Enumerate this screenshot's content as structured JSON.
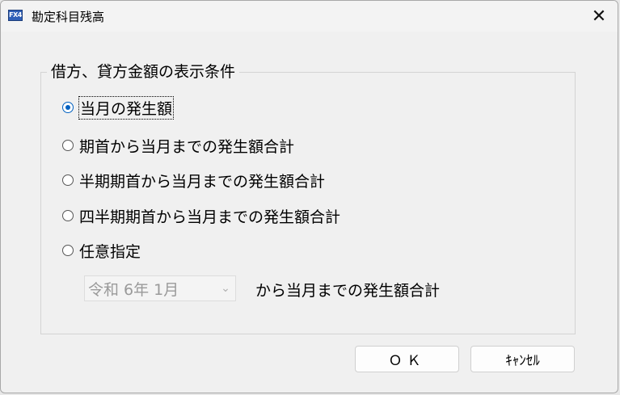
{
  "window": {
    "title": "勘定科目残高",
    "app_icon_text": "FX4",
    "close_glyph": "✕"
  },
  "group": {
    "caption": "借方、貸方金額の表示条件",
    "options": [
      {
        "label": "当月の発生額",
        "checked": true
      },
      {
        "label": "期首から当月までの発生額合計",
        "checked": false
      },
      {
        "label": "半期期首から当月までの発生額合計",
        "checked": false
      },
      {
        "label": "四半期期首から当月までの発生額合計",
        "checked": false
      },
      {
        "label": "任意指定",
        "checked": false
      }
    ],
    "period_select": {
      "value": "令和  6年  1月",
      "enabled": false
    },
    "period_suffix": "から当月までの発生額合計"
  },
  "buttons": {
    "ok": "ＯＫ",
    "cancel": "ｷｬﾝｾﾙ"
  },
  "colors": {
    "accent": "#0060c0",
    "dialog_bg": "#f0f0f0",
    "disabled_text": "#9a9a9a"
  }
}
